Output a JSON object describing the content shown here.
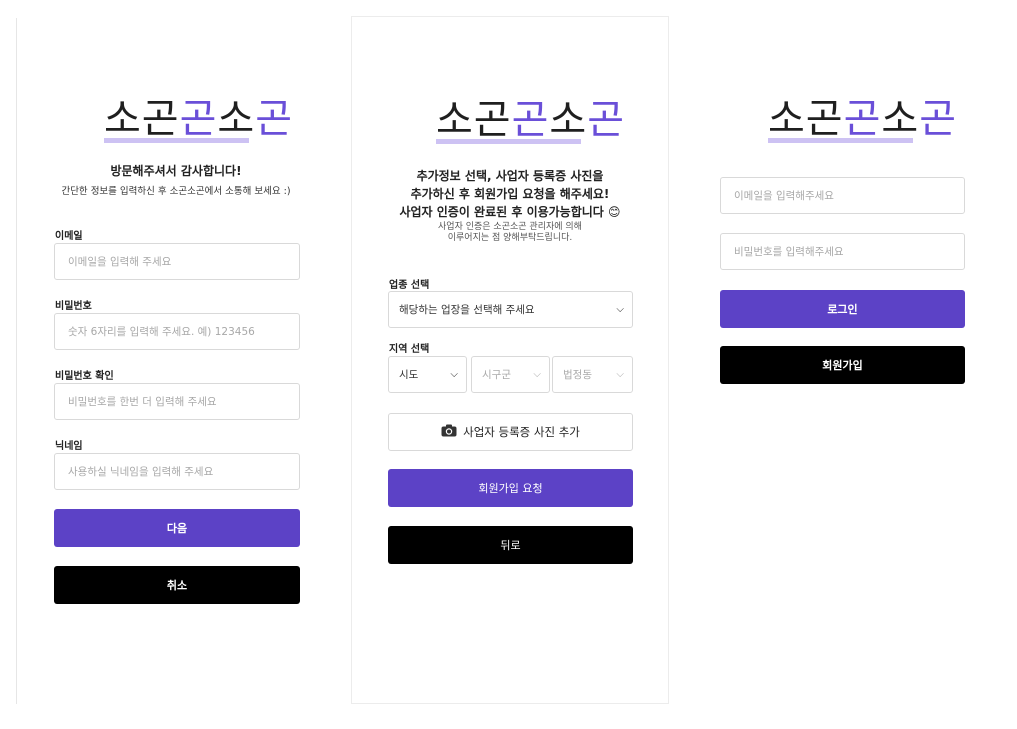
{
  "brand": {
    "logo_part1": "소곤",
    "logo_part2": "소",
    "logo_part3": "곤",
    "color_dark": "#1f1f1f",
    "color_accent": "#6a4fd8"
  },
  "signup_step1": {
    "heading": "방문해주셔서 감사합니다!",
    "subtext": "간단한 정보를 입력하신 후 소곤소곤에서 소통해 보세요 :)",
    "email_label": "이메일",
    "email_placeholder": "이메일을 입력해 주세요",
    "password_label": "비밀번호",
    "password_placeholder": "숫자 6자리를 입력해 주세요. 예) 123456",
    "password_confirm_label": "비밀번호 확인",
    "password_confirm_placeholder": "비밀번호를 한번 더 입력해 주세요",
    "nickname_label": "닉네임",
    "nickname_placeholder": "사용하실 닉네임을 입력해 주세요",
    "next_button": "다음",
    "cancel_button": "취소"
  },
  "signup_step2": {
    "heading_line1": "추가정보 선택, 사업자 등록증 사진을",
    "heading_line2": "추가하신 후 회원가입 요청을 해주세요!",
    "heading_line3": "사업자 인증이 완료된 후 이용가능합니다 😊",
    "note_line1": "사업자 인증은 소곤소곤 관리자에 의해",
    "note_line2": "이루어지는 점 양해부탁드립니다.",
    "business_label": "업종 선택",
    "business_select": "해당하는 업장을 선택해 주세요",
    "region_label": "지역 선택",
    "region_sido": "시도",
    "region_sigungu": "시구군",
    "region_dong": "법정동",
    "photo_button": "사업자 등록증 사진 추가",
    "submit_button": "회원가입 요청",
    "back_button": "뒤로"
  },
  "login": {
    "email_placeholder": "이메일을 입력해주세요",
    "password_placeholder": "비밀번호를 입력해주세요",
    "login_button": "로그인",
    "signup_button": "회원가입"
  },
  "colors": {
    "primary": "#5c42c6",
    "secondary": "#000000",
    "border": "#d9d9d9"
  }
}
